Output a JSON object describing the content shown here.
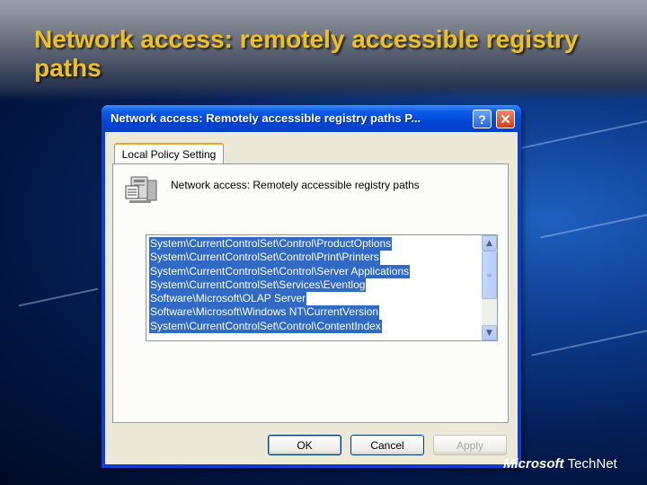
{
  "slide": {
    "title": "Network access: remotely accessible registry paths"
  },
  "dialog": {
    "title": "Network access: Remotely accessible registry paths P...",
    "help_label": "?",
    "close_label": "✕",
    "tab_label": "Local Policy Setting",
    "policy_name": "Network access: Remotely accessible registry paths",
    "registry_paths": [
      "System\\CurrentControlSet\\Control\\ProductOptions",
      "System\\CurrentControlSet\\Control\\Print\\Printers",
      "System\\CurrentControlSet\\Control\\Server Applications",
      "System\\CurrentControlSet\\Services\\Eventlog",
      "Software\\Microsoft\\OLAP Server",
      "Software\\Microsoft\\Windows NT\\CurrentVersion",
      "System\\CurrentControlSet\\Control\\ContentIndex"
    ],
    "buttons": {
      "ok": "OK",
      "cancel": "Cancel",
      "apply": "Apply"
    }
  },
  "branding": {
    "logo_bold": "Microsoft",
    "logo_rest": "TechNet"
  },
  "colors": {
    "title_yellow": "#f0c020",
    "selection_blue": "#316ac5",
    "dialog_frame": "#0a3fd0"
  }
}
